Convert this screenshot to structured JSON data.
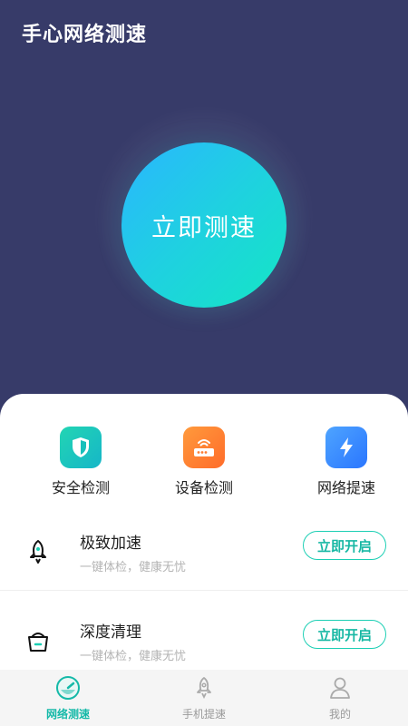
{
  "header": {
    "title": "手心网络测速"
  },
  "speedtest": {
    "button_label": "立即测速"
  },
  "features": [
    {
      "label": "安全检测",
      "icon": "shield-icon",
      "color": "#22d5b3"
    },
    {
      "label": "设备检测",
      "icon": "router-icon",
      "color": "#ff7e33"
    },
    {
      "label": "网络提速",
      "icon": "lightning-icon",
      "color": "#3a8bff"
    }
  ],
  "tools": [
    {
      "title": "极致加速",
      "subtitle": "一键体检，健康无忧",
      "button": "立即开启",
      "icon": "rocket-icon"
    },
    {
      "title": "深度清理",
      "subtitle": "一键体检，健康无忧",
      "button": "立即开启",
      "icon": "clean-bag-icon"
    }
  ],
  "tabbar": [
    {
      "label": "网络测速",
      "icon": "speedometer-icon",
      "active": true
    },
    {
      "label": "手机提速",
      "icon": "rocket-icon",
      "active": false
    },
    {
      "label": "我的",
      "icon": "user-icon",
      "active": false
    }
  ],
  "colors": {
    "background": "#373b69",
    "accent": "#15b9a8"
  }
}
